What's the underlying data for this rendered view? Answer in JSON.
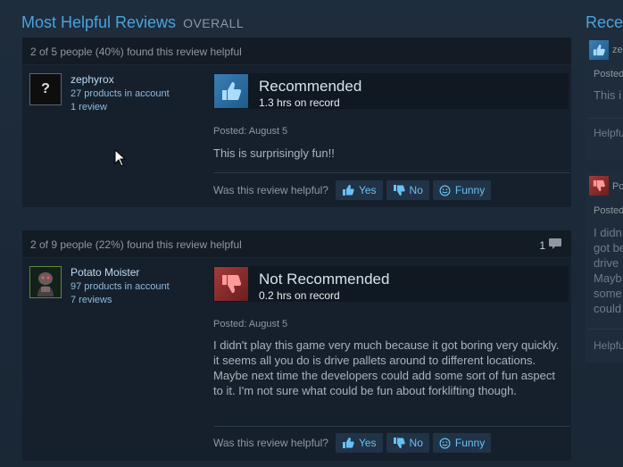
{
  "header": {
    "title": "Most Helpful Reviews",
    "subtitle": "OVERALL"
  },
  "reviews": [
    {
      "helpful_text": "2 of 5 people (40%) found this review helpful",
      "comment_count": "",
      "author": {
        "name": "zephyrox",
        "products": "27 products in account",
        "reviews": "1 review"
      },
      "avatar_glyph": "?",
      "vote": "Recommended",
      "hours": "1.3 hrs on record",
      "posted": "Posted: August 5",
      "text": "This is surprisingly fun!!",
      "helpful_question": "Was this review helpful?",
      "buttons": {
        "yes": "Yes",
        "no": "No",
        "funny": "Funny"
      }
    },
    {
      "helpful_text": "2 of 9 people (22%) found this review helpful",
      "comment_count": "1",
      "author": {
        "name": "Potato Moister",
        "products": "97 products in account",
        "reviews": "7 reviews"
      },
      "vote": "Not Recommended",
      "hours": "0.2 hrs on record",
      "posted": "Posted: August 5",
      "text": "I didn't play this game very much because it got boring very quickly. it seems all you do is drive pallets around to different locations. Maybe next time the developers could add some sort of fun aspect to it. I'm not sure what could be fun about forklifting though.",
      "helpful_question": "Was this review helpful?",
      "buttons": {
        "yes": "Yes",
        "no": "No",
        "funny": "Funny"
      }
    }
  ],
  "sidebar": {
    "title": "Rece",
    "items": [
      {
        "name_partial": "ze",
        "posted_partial": "Posted",
        "text_partial": "This i",
        "helpful_partial": "Helpfu"
      },
      {
        "name_partial": "Pc",
        "posted_partial": "Posted",
        "lines_partial": [
          "I didn",
          "got be",
          "drive",
          "Mayb",
          "some",
          "could"
        ],
        "helpful_partial": "Helpfu"
      }
    ]
  },
  "colors": {
    "accent": "#4aa3dc",
    "recommended": "#3a7fb4",
    "not_recommended": "#a33a3a",
    "link": "#67c1f5"
  },
  "icons": [
    "thumbs-up-icon",
    "thumbs-down-icon",
    "smiley-icon",
    "comment-bubble-icon",
    "mouse-cursor-icon"
  ]
}
